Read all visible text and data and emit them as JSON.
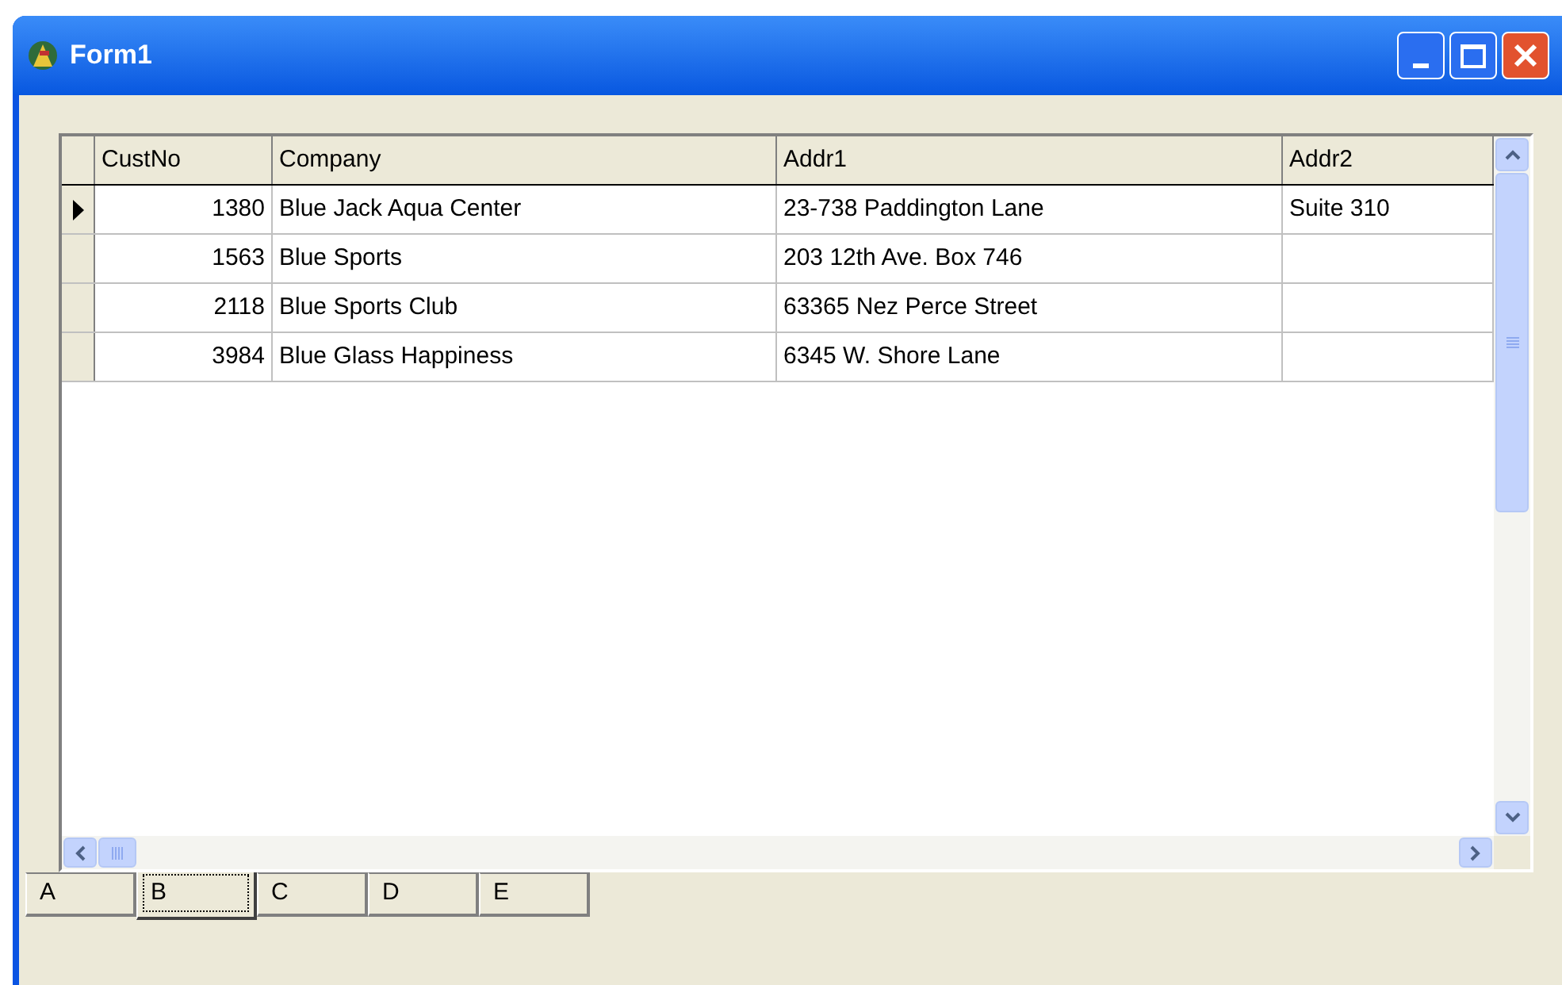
{
  "window": {
    "title": "Form1"
  },
  "table": {
    "columns": [
      "CustNo",
      "Company",
      "Addr1",
      "Addr2"
    ],
    "rows": [
      {
        "current": true,
        "cells": [
          "1380",
          "Blue Jack Aqua Center",
          "23-738 Paddington Lane",
          "Suite 310"
        ]
      },
      {
        "current": false,
        "cells": [
          "1563",
          "Blue Sports",
          "203 12th Ave. Box 746",
          ""
        ]
      },
      {
        "current": false,
        "cells": [
          "2118",
          "Blue Sports Club",
          "63365 Nez Perce Street",
          ""
        ]
      },
      {
        "current": false,
        "cells": [
          "3984",
          "Blue Glass Happiness",
          "6345 W. Shore Lane",
          ""
        ]
      }
    ]
  },
  "tabs": [
    {
      "label": "A",
      "selected": false
    },
    {
      "label": "B",
      "selected": true
    },
    {
      "label": "C",
      "selected": false
    },
    {
      "label": "D",
      "selected": false
    },
    {
      "label": "E",
      "selected": false
    }
  ]
}
